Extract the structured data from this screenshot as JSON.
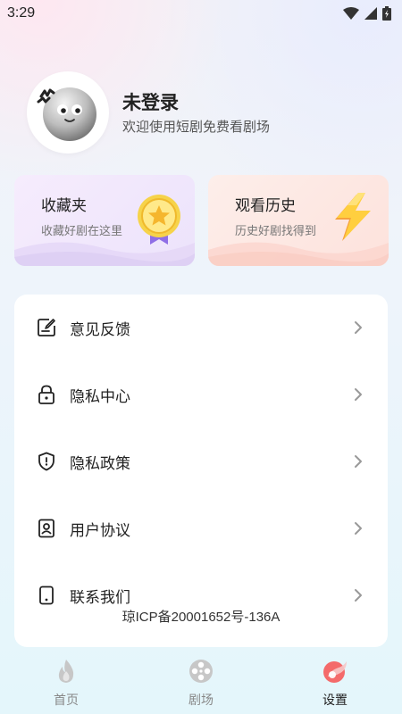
{
  "status_bar": {
    "time": "3:29"
  },
  "profile": {
    "name": "未登录",
    "subtitle": "欢迎使用短剧免费看剧场"
  },
  "cards": [
    {
      "title": "收藏夹",
      "subtitle": "收藏好剧在这里",
      "icon": "medal-icon"
    },
    {
      "title": "观看历史",
      "subtitle": "历史好剧找得到",
      "icon": "lightning-icon"
    }
  ],
  "menu": {
    "items": [
      {
        "label": "意见反馈",
        "icon": "feedback-icon"
      },
      {
        "label": "隐私中心",
        "icon": "lock-icon"
      },
      {
        "label": "隐私政策",
        "icon": "shield-icon"
      },
      {
        "label": "用户协议",
        "icon": "user-agreement-icon"
      },
      {
        "label": "联系我们",
        "icon": "phone-icon"
      }
    ]
  },
  "icp": "琼ICP备20001652号-136A",
  "tab_bar": {
    "tabs": [
      {
        "label": "首页",
        "icon": "flame-icon",
        "active": false
      },
      {
        "label": "剧场",
        "icon": "film-reel-icon",
        "active": false
      },
      {
        "label": "设置",
        "icon": "settings-icon",
        "active": true
      }
    ]
  },
  "colors": {
    "accent": "#f46a6a",
    "card_fav_bg": "#f1e8fc",
    "card_hist_bg": "#fde6e1",
    "tab_inactive": "#c0c0c0"
  }
}
